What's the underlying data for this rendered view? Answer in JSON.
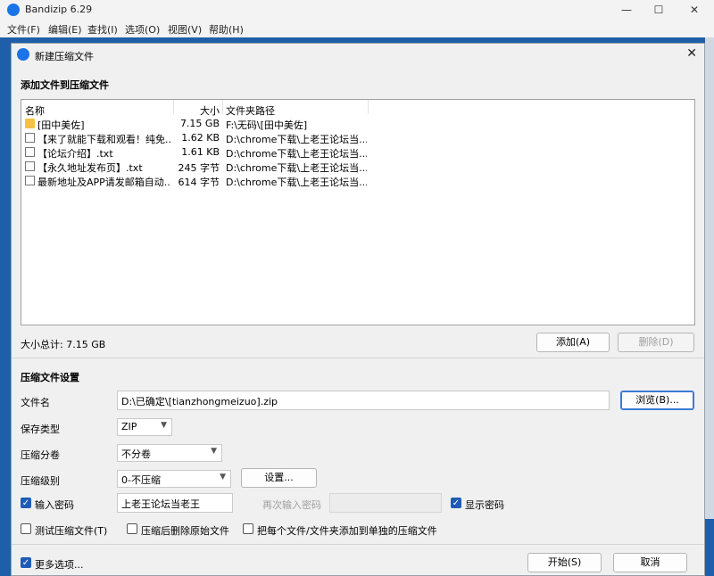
{
  "window": {
    "title": "Bandizip 6.29"
  },
  "window_controls": {
    "minimize": "—",
    "maximize": "☐",
    "close": "✕"
  },
  "menu": [
    "文件(F)",
    "编辑(E)",
    "查找(I)",
    "选项(O)",
    "视图(V)",
    "帮助(H)"
  ],
  "dialog": {
    "title": "新建压缩文件",
    "close": "✕",
    "add_section_title": "添加文件到压缩文件",
    "columns": {
      "name": "名称",
      "size": "大小",
      "path": "文件夹路径"
    },
    "files": [
      {
        "icon": "folder-icon",
        "name": "[田中美佐]",
        "size": "7.15 GB",
        "path": "F:\\无码\\[田中美佐]"
      },
      {
        "icon": "text-file-icon",
        "name": "【来了就能下载和观看！纯免...",
        "size": "1.62 KB",
        "path": "D:\\chrome下载\\上老王论坛当..."
      },
      {
        "icon": "text-file-icon",
        "name": "【论坛介绍】.txt",
        "size": "1.61 KB",
        "path": "D:\\chrome下载\\上老王论坛当..."
      },
      {
        "icon": "text-file-icon",
        "name": "【永久地址发布页】.txt",
        "size": "245 字节",
        "path": "D:\\chrome下载\\上老王论坛当..."
      },
      {
        "icon": "text-file-icon",
        "name": "最新地址及APP请发邮箱自动...",
        "size": "614 字节",
        "path": "D:\\chrome下载\\上老王论坛当..."
      }
    ],
    "total_size": "大小总计: 7.15 GB",
    "add_button": "添加(A)",
    "delete_button": "删除(D)",
    "settings_section_title": "压缩文件设置",
    "filename_label": "文件名",
    "filename_value": "D:\\已确定\\[tianzhongmeizuo].zip",
    "browse_button": "浏览(B)...",
    "save_type_label": "保存类型",
    "save_type_value": "ZIP",
    "split_label": "压缩分卷",
    "split_value": "不分卷",
    "level_label": "压缩级别",
    "level_value": "0-不压缩",
    "settings_button": "设置...",
    "password_checkbox": {
      "label": "输入密码",
      "checked": true
    },
    "password_value": "上老王论坛当老王",
    "reenter_password_label": "再次输入密码",
    "show_password": {
      "label": "显示密码",
      "checked": true
    },
    "test_archive": {
      "label": "测试压缩文件(T)",
      "checked": false
    },
    "delete_originals": {
      "label": "压缩后删除原始文件",
      "checked": false
    },
    "each_to_separate": {
      "label": "把每个文件/文件夹添加到单独的压缩文件",
      "checked": false
    },
    "more_options": {
      "label": "更多选项...",
      "checked": true
    },
    "start_button": "开始(S)",
    "cancel_button": "取消"
  },
  "colors": {
    "accent": "#1e5bb8",
    "desktop": "#1f5ea8",
    "folder": "#f5c242"
  }
}
